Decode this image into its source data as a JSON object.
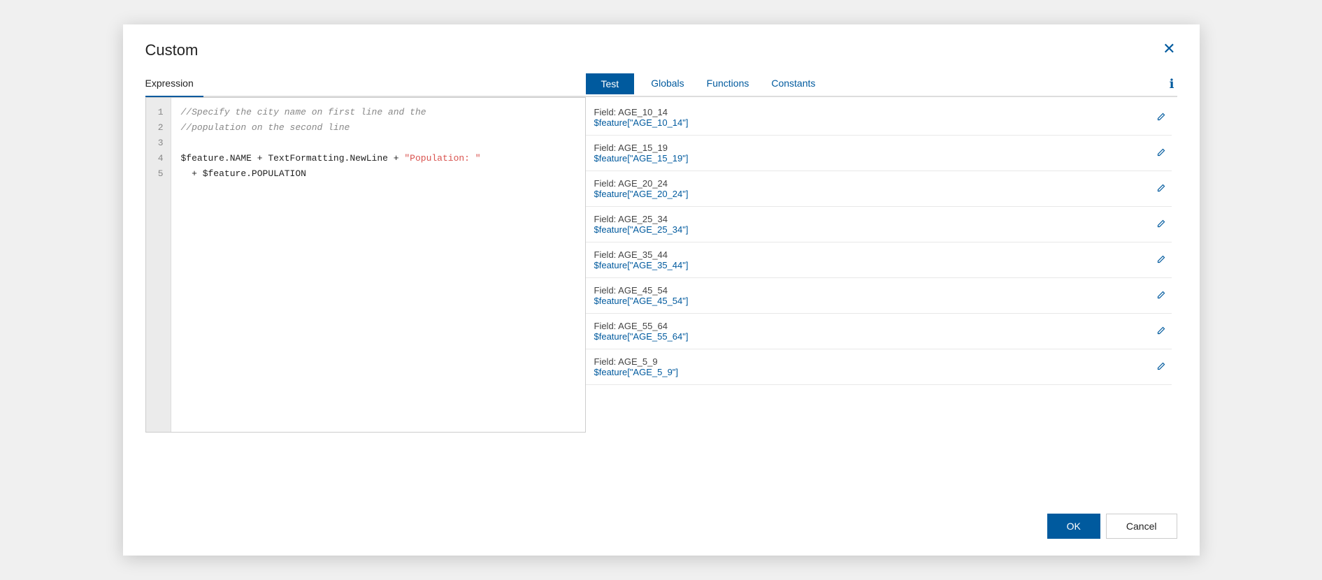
{
  "dialog": {
    "title": "Custom",
    "close_label": "✕"
  },
  "left_panel": {
    "tab_expression": "Expression"
  },
  "right_panel": {
    "test_label": "Test",
    "globals_label": "Globals",
    "functions_label": "Functions",
    "constants_label": "Constants",
    "info_icon": "ℹ"
  },
  "code_lines": [
    {
      "num": "1",
      "content_type": "comment",
      "text": "//Specify the city name on first line and the"
    },
    {
      "num": "2",
      "content_type": "comment",
      "text": "//population on the second line"
    },
    {
      "num": "3",
      "content_type": "empty",
      "text": ""
    },
    {
      "num": "4",
      "content_type": "mixed",
      "text": "$feature.NAME + TextFormatting.NewLine + \"Population: \""
    },
    {
      "num": "5",
      "content_type": "variable",
      "text": "  + $feature.POPULATION"
    }
  ],
  "globals_fields": [
    {
      "label": "Field: AGE_10_14",
      "value": "$feature[\"AGE_10_14\"]"
    },
    {
      "label": "Field: AGE_15_19",
      "value": "$feature[\"AGE_15_19\"]"
    },
    {
      "label": "Field: AGE_20_24",
      "value": "$feature[\"AGE_20_24\"]"
    },
    {
      "label": "Field: AGE_25_34",
      "value": "$feature[\"AGE_25_34\"]"
    },
    {
      "label": "Field: AGE_35_44",
      "value": "$feature[\"AGE_35_44\"]"
    },
    {
      "label": "Field: AGE_45_54",
      "value": "$feature[\"AGE_45_54\"]"
    },
    {
      "label": "Field: AGE_55_64",
      "value": "$feature[\"AGE_55_64\"]"
    },
    {
      "label": "Field: AGE_5_9",
      "value": "$feature[\"AGE_5_9\"]"
    }
  ],
  "footer": {
    "ok_label": "OK",
    "cancel_label": "Cancel"
  }
}
